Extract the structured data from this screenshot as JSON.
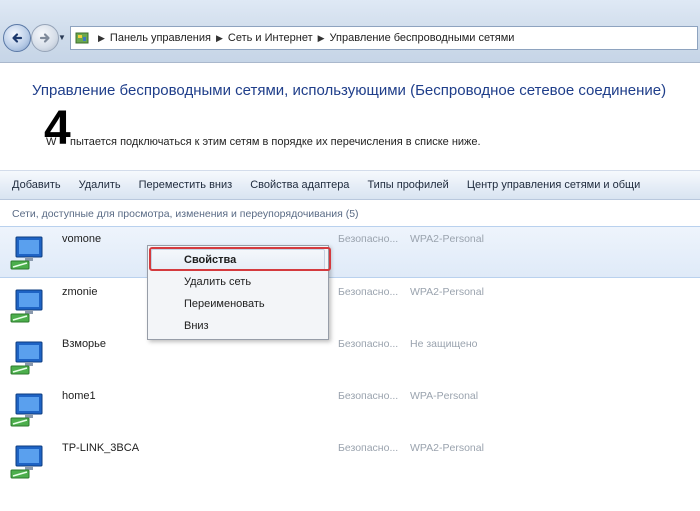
{
  "address_bar": {
    "breadcrumbs": [
      "Панель управления",
      "Сеть и Интернет",
      "Управление беспроводными сетями"
    ]
  },
  "header": {
    "title": "Управление беспроводными сетями, использующими (Беспроводное сетевое соединение)",
    "step_number": "4",
    "description_prefix": "W",
    "description": "пытается подключаться к этим сетям в порядке их перечисления в списке ниже."
  },
  "toolbar": {
    "items": [
      "Добавить",
      "Удалить",
      "Переместить вниз",
      "Свойства адаптера",
      "Типы профилей",
      "Центр управления сетями и общи"
    ]
  },
  "list": {
    "group_header": "Сети, доступные для просмотра, изменения и переупорядочивания (5)",
    "networks": [
      {
        "name": "vomone",
        "security": "Безопасно...",
        "type": "WPA2-Personal"
      },
      {
        "name": "zmonie",
        "security": "Безопасно...",
        "type": "WPA2-Personal"
      },
      {
        "name": "Взморье",
        "security": "Безопасно...",
        "type": "Не защищено"
      },
      {
        "name": "home1",
        "security": "Безопасно...",
        "type": "WPA-Personal"
      },
      {
        "name": "TP-LINK_3BCA",
        "security": "Безопасно...",
        "type": "WPA2-Personal"
      }
    ]
  },
  "context_menu": {
    "items": [
      "Свойства",
      "Удалить сеть",
      "Переименовать",
      "Вниз"
    ]
  },
  "colors": {
    "heading": "#1f3e8a",
    "highlight_border": "#d43a3e",
    "secondary_text": "#9aa3ae"
  },
  "icons": [
    "back-arrow-icon",
    "forward-arrow-icon",
    "control-panel-icon",
    "wireless-network-icon"
  ]
}
